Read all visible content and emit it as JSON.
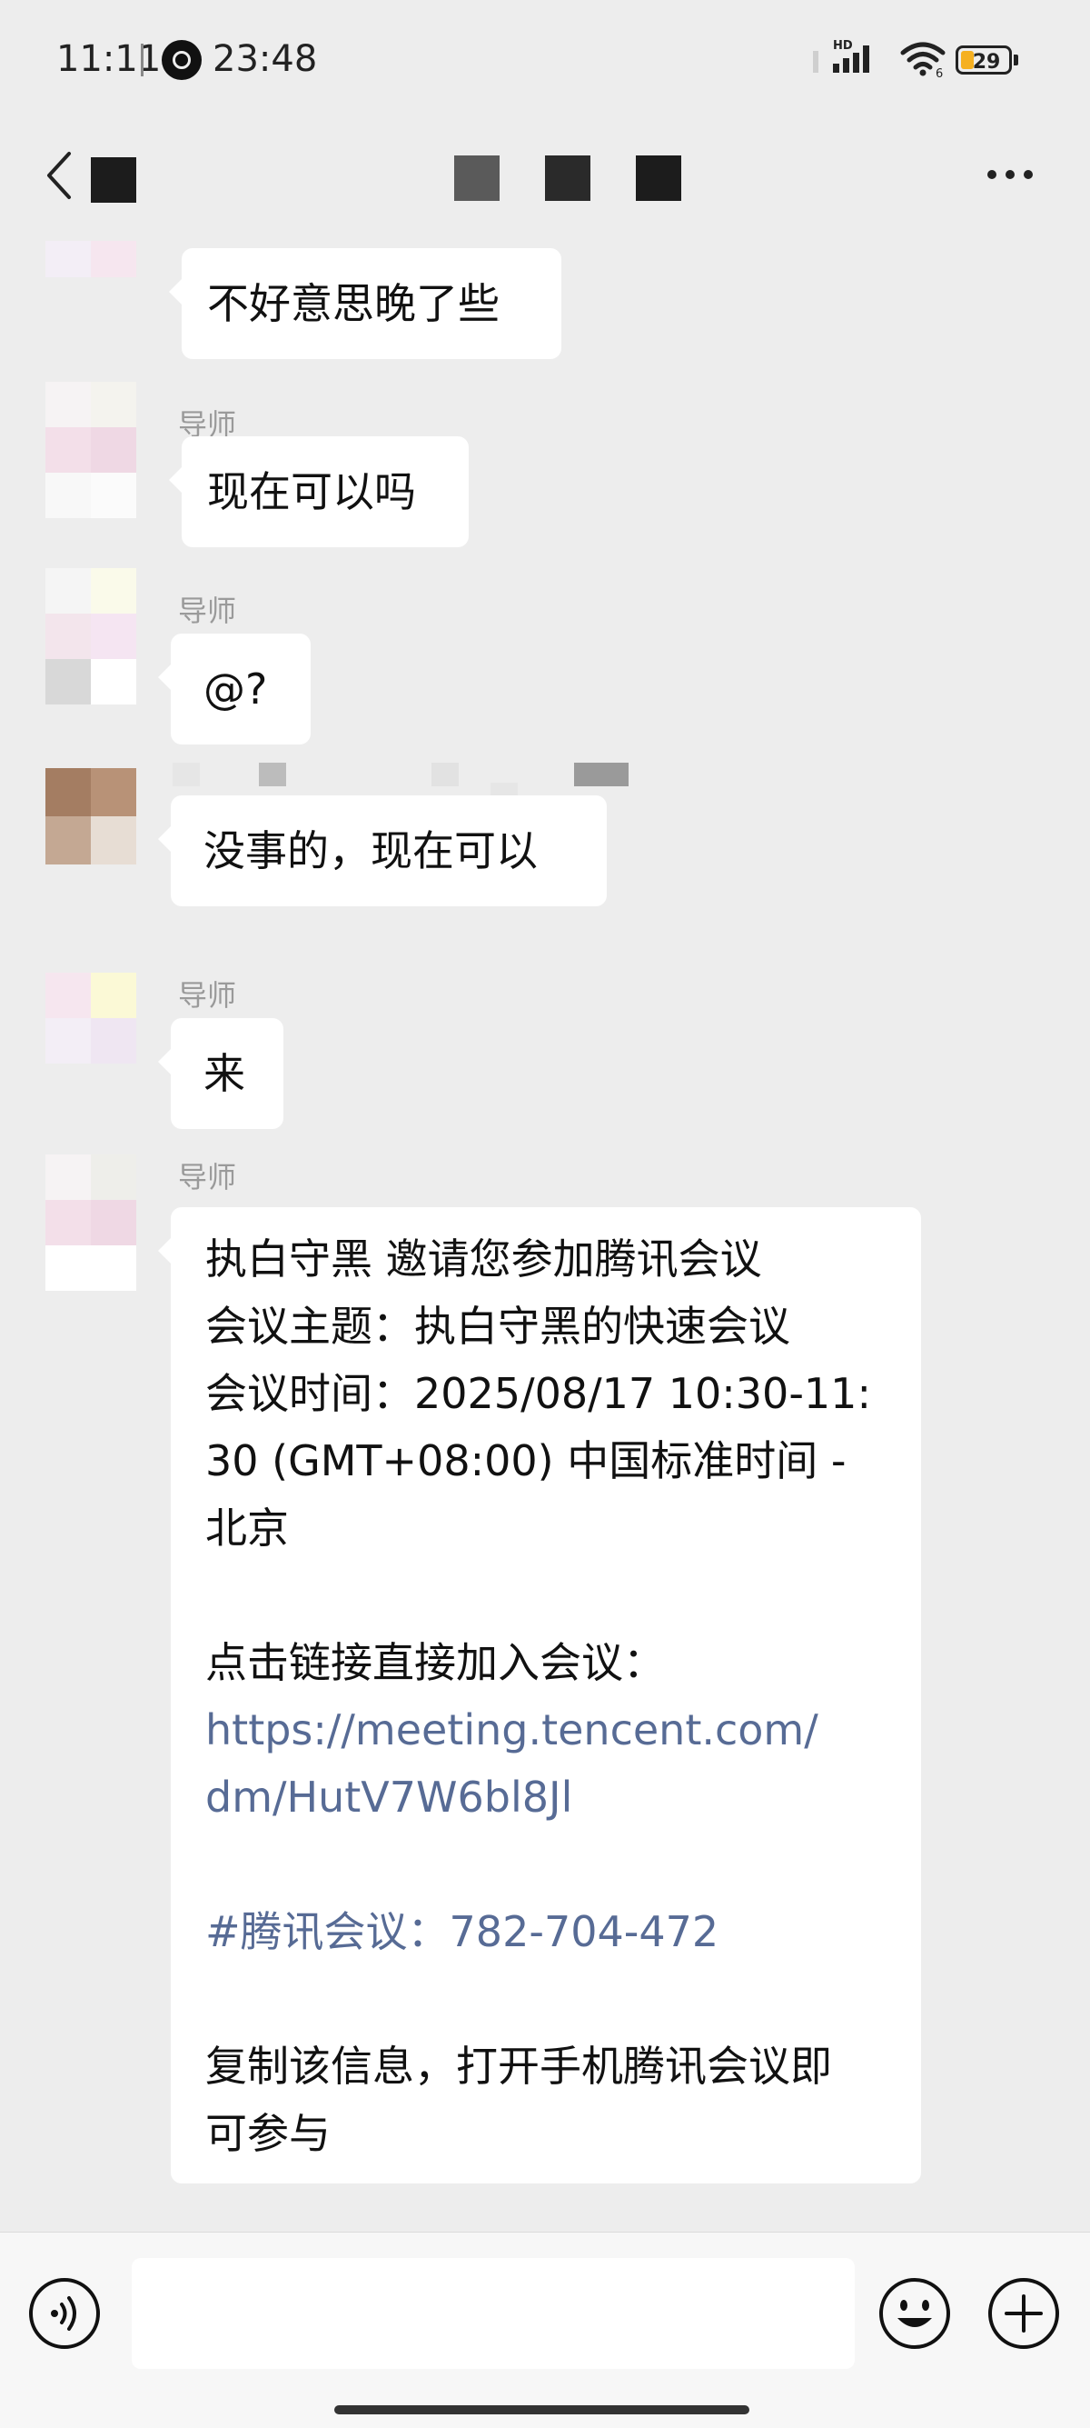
{
  "status_bar": {
    "time": "11:11",
    "secondary_clock": "23:48",
    "battery_level": "29",
    "battery_fraction": 0.29,
    "icons": [
      "alarm-clock-icon",
      "signal-hd-icon",
      "wifi-icon",
      "battery-icon"
    ]
  },
  "top_bar": {
    "icons": [
      "back-chevron-icon",
      "more-dots-icon"
    ]
  },
  "messages": [
    {
      "sender": "",
      "text": "不好意思晚了些"
    },
    {
      "sender": "导师",
      "text": "现在可以吗"
    },
    {
      "sender": "导师",
      "text": "@?"
    },
    {
      "sender": "",
      "text": "没事的，现在可以"
    },
    {
      "sender": "导师",
      "text": "来"
    },
    {
      "sender": "导师",
      "lines": [
        "执白守黑 邀请您参加腾讯会议",
        "会议主题：执白守黑的快速会议",
        "会议时间：2025/08/17 10:30-11:",
        "30 (GMT+08:00) 中国标准时间 -",
        "北京",
        "点击链接直接加入会议：",
        "https://meeting.tencent.com/",
        "dm/HutV7W6bl8Jl",
        "#腾讯会议：782-704-472",
        "复制该信息，打开手机腾讯会议即",
        "可参与"
      ]
    }
  ],
  "input_bar": {
    "placeholder": "",
    "icons": [
      "voice-icon",
      "emoji-icon",
      "plus-icon"
    ]
  },
  "colors": {
    "background": "#ededed",
    "bubble": "#ffffff",
    "link": "#576b95",
    "sender_name": "#9a9a9a"
  }
}
